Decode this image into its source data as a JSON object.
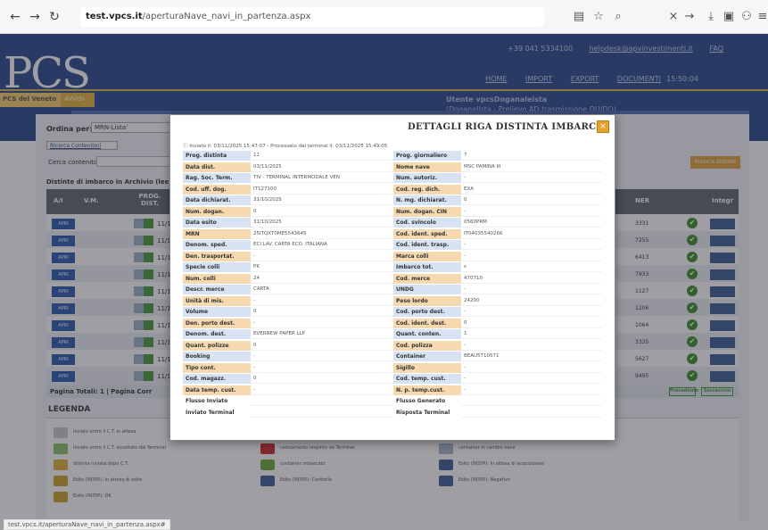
{
  "browser": {
    "url_host": "test.vpcs.it",
    "url_path": "/aperturaNave_navi_in_partenza.aspx",
    "status_url": "test.vpcs.it/aperturaNave_navi_in_partenza.aspx#"
  },
  "header": {
    "logo": "PCS",
    "phone": "+39 041 5334100",
    "email": "helpdesk@apvinvestimenti.it",
    "faq": "FAQ",
    "menu": [
      "HOME",
      "IMPORT",
      "EXPORT",
      "DOCUMENTI"
    ],
    "clock": "15:50:04",
    "section_label": "PCS del Veneto",
    "avvisi": "AVVISI",
    "user_line1": "Utente vpcsDoganaleista",
    "user_line2": "(Doganalista - Prelievo AD trasmissione DU/DO)"
  },
  "content": {
    "ordina_label": "Ordina per:",
    "ordina_value": "MRN-Listaʼ",
    "ricerca_tab": "Ricerca Contenitori",
    "cerca_label": "Cerca contenitore:",
    "distinte_title": "Distinte di imbarco in Archivio (lee",
    "cerca_btn": "Ricerca distinte",
    "columns": [
      "A/I",
      "V.M.",
      "PROG. DIST.",
      "NER",
      "Integr"
    ],
    "rows": [
      {
        "apri": "APRI",
        "dist": "11/1",
        "num": "3331"
      },
      {
        "apri": "APRI",
        "dist": "11/1",
        "num": "7255"
      },
      {
        "apri": "APRI",
        "dist": "11/1",
        "num": "6413"
      },
      {
        "apri": "APRI",
        "dist": "11/1",
        "num": "7933"
      },
      {
        "apri": "APRI",
        "dist": "11/1",
        "num": "1127"
      },
      {
        "apri": "APRI",
        "dist": "11/1",
        "num": "1206"
      },
      {
        "apri": "APRI",
        "dist": "11/1",
        "num": "1064"
      },
      {
        "apri": "APRI",
        "dist": "11/1",
        "num": "3335"
      },
      {
        "apri": "APRI",
        "dist": "11/1",
        "num": "5627"
      },
      {
        "apri": "APRI",
        "dist": "11/1",
        "num": "9495"
      }
    ],
    "footer_left": "Pagina Totali: 1  |  Pagina Corr",
    "prev": "Precedente",
    "next": "Successivo",
    "legenda": "LEGENDA",
    "legend_items": [
      "Inviato entro il C.T. in attesa",
      "Inviato entro il C.T. accettato dal Terminal",
      "distinta inviata dopo C.T.",
      "Esito (IN35P): in attesa di esito",
      "Esito (IN35P): OK",
      "caricamento respinto da Terminal",
      "container imbarcato",
      "Esito (IN35P): Controllo",
      "container in cambio nave",
      "Esito (IN35P): In attesa di acquisizione",
      "Esito (IN35P): Negativo"
    ]
  },
  "modal": {
    "title": "DETTAGLI RIGA DISTINTA IMBARCO",
    "close": "×",
    "meta": "Inviato il: 03/11/2025 15:47:07 - Processato dal terminal il: 03/11/2025 15:49:05",
    "rows": [
      {
        "ll": "Prog. distinta",
        "lv": "11",
        "rl": "Prog. giornaliero",
        "rv": "7",
        "lc": "bg-blue",
        "rc": "bg-blue"
      },
      {
        "ll": "Data dist.",
        "lv": "03/11/2025",
        "rl": "Nome nave",
        "rv": "MSC PAMINA III",
        "lc": "bg-orange",
        "rc": "bg-orange"
      },
      {
        "ll": "Rag. Soc. Term.",
        "lv": "TIV - TERMINAL INTERMODALE VEN",
        "rl": "Num. autoriz.",
        "rv": "-",
        "lc": "bg-blue",
        "rc": "bg-blue"
      },
      {
        "ll": "Cod. uff. dog.",
        "lv": "IT127100",
        "rl": "Cod. reg. dich.",
        "rv": "EXA",
        "lc": "bg-orange",
        "rc": "bg-orange"
      },
      {
        "ll": "Data dichiarat.",
        "lv": "31/10/2025",
        "rl": "N. mg. dichiarat.",
        "rv": "0",
        "lc": "bg-blue",
        "rc": "bg-blue"
      },
      {
        "ll": "Num. dogan.",
        "lv": "0",
        "rl": "Num. dogan. CIN",
        "rv": "-",
        "lc": "bg-orange",
        "rc": "bg-orange"
      },
      {
        "ll": "Data esito",
        "lv": "31/10/2025",
        "rl": "Cod. svincolo",
        "rv": "0560PRM",
        "lc": "bg-blue",
        "rc": "bg-blue"
      },
      {
        "ll": "MRN",
        "lv": "25ITQXT0ME5543645",
        "rl": "Cod. ident. sped.",
        "rv": "IT04035540266",
        "lc": "bg-orange",
        "rc": "bg-orange"
      },
      {
        "ll": "Denom. sped.",
        "lv": "ECI LAV. CARTA ECO. ITALIANA",
        "rl": "Cod. ident. trasp.",
        "rv": "-",
        "lc": "bg-blue",
        "rc": "bg-blue"
      },
      {
        "ll": "Den. trasportat.",
        "lv": "-",
        "rl": "Marca colli",
        "rv": "-",
        "lc": "bg-orange",
        "rc": "bg-orange"
      },
      {
        "ll": "Specie colli",
        "lv": "PK",
        "rl": "Imbarco tot.",
        "rv": "s",
        "lc": "bg-blue",
        "rc": "bg-blue"
      },
      {
        "ll": "Num. colli",
        "lv": "24",
        "rl": "Cod. merce",
        "rv": "470710",
        "lc": "bg-orange",
        "rc": "bg-orange"
      },
      {
        "ll": "Descr. merce",
        "lv": "CARTA",
        "rl": "UNDG",
        "rv": "-",
        "lc": "bg-blue",
        "rc": "bg-blue"
      },
      {
        "ll": "Unità di mis.",
        "lv": "-",
        "rl": "Peso lordo",
        "rv": "24200",
        "lc": "bg-orange",
        "rc": "bg-orange"
      },
      {
        "ll": "Volume",
        "lv": "0",
        "rl": "Cod. porto dest.",
        "rv": "-",
        "lc": "bg-blue",
        "rc": "bg-blue"
      },
      {
        "ll": "Den. porto dest.",
        "lv": "-",
        "rl": "Cod. ident. dest.",
        "rv": "0",
        "lc": "bg-orange",
        "rc": "bg-orange"
      },
      {
        "ll": "Denom. dest.",
        "lv": "EVERNEW PAPER LLP",
        "rl": "Quant. conten.",
        "rv": "1",
        "lc": "bg-blue",
        "rc": "bg-blue"
      },
      {
        "ll": "Quant. polizze",
        "lv": "0",
        "rl": "Cod. polizza",
        "rv": "-",
        "lc": "bg-orange",
        "rc": "bg-orange"
      },
      {
        "ll": "Booking",
        "lv": "-",
        "rl": "Container",
        "rv": "BEAU5710571",
        "lc": "bg-blue",
        "rc": "bg-blue"
      },
      {
        "ll": "Tipo cont.",
        "lv": "-",
        "rl": "Sigillo",
        "rv": "-",
        "lc": "bg-orange",
        "rc": "bg-orange"
      },
      {
        "ll": "Cod. magazz.",
        "lv": "0",
        "rl": "Cod. temp. cust.",
        "rv": "-",
        "lc": "bg-blue",
        "rc": "bg-blue"
      },
      {
        "ll": "Data temp. cust.",
        "lv": "-",
        "rl": "N. p. temp.cust.",
        "rv": "-",
        "lc": "bg-orange",
        "rc": "bg-orange"
      },
      {
        "ll": "Flusso Inviato",
        "lv": "",
        "rl": "Flusso Generato",
        "rv": "",
        "lc": "bg-white",
        "rc": "bg-white"
      },
      {
        "ll": "Inviato Terminal",
        "lv": "",
        "rl": "Risposta Terminal",
        "rv": "",
        "lc": "bg-white",
        "rc": "bg-white"
      }
    ]
  }
}
